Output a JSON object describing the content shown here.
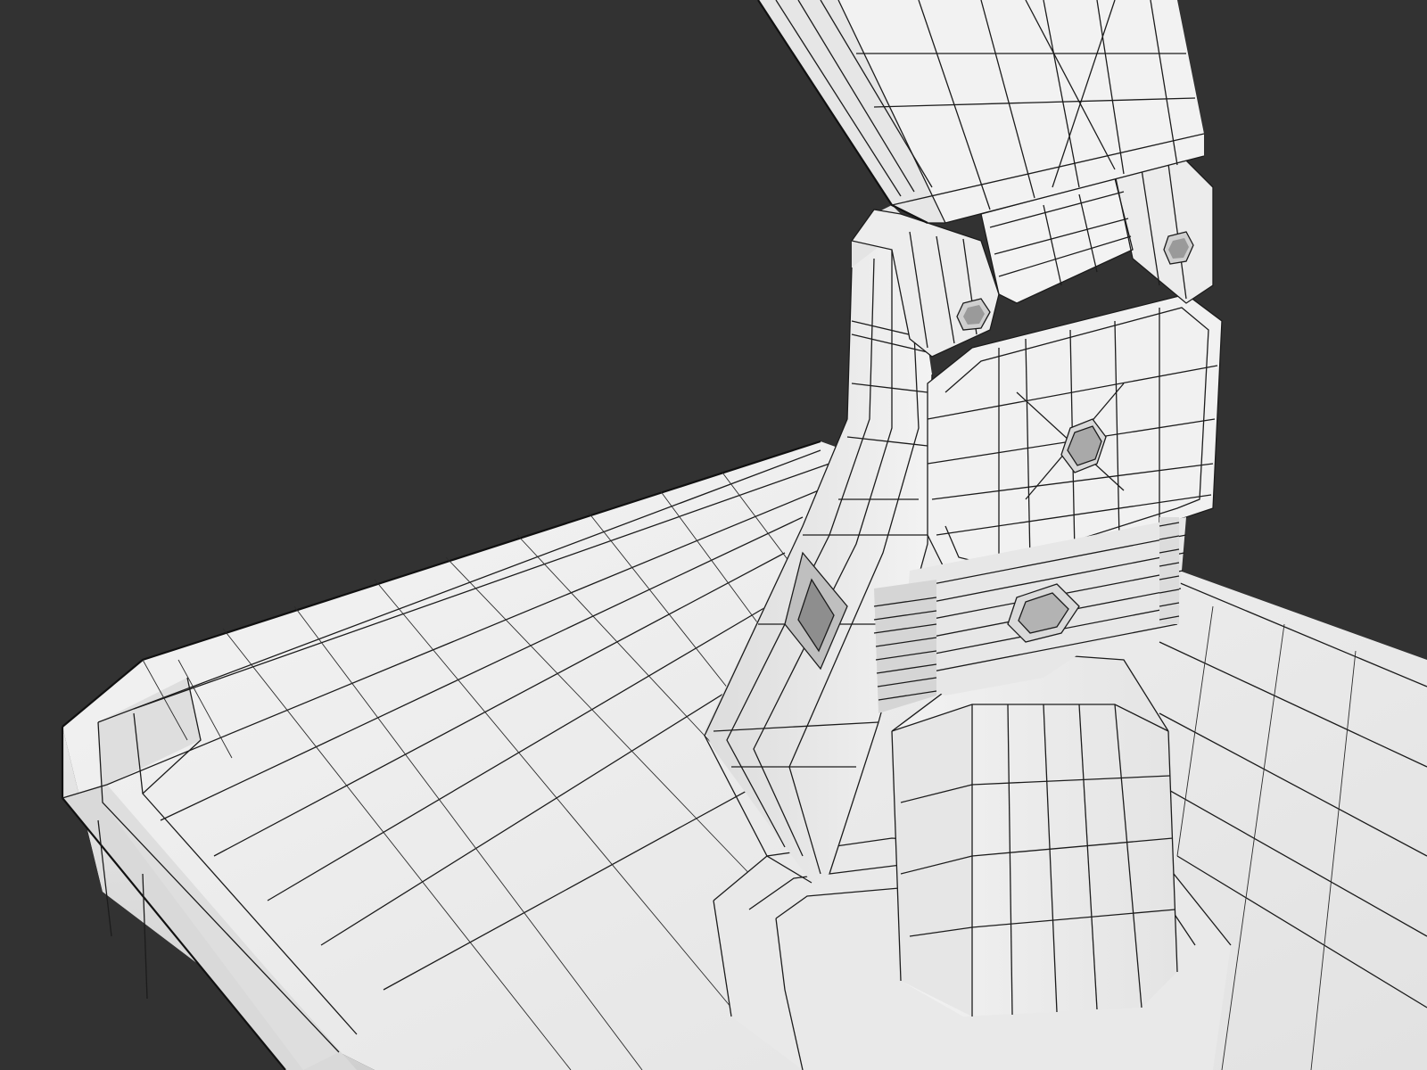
{
  "scene": {
    "render_mode": "wireframe-on-shaded",
    "background_color": "#323232",
    "surface_color": "#efefef",
    "shadow_color": "#c9c9c9",
    "wire_color": "#1c1c1c",
    "objects": [
      "base-plate",
      "pedestal",
      "lower-arm",
      "joint-bracket",
      "upper-arm",
      "joint-pins",
      "side-window"
    ]
  }
}
